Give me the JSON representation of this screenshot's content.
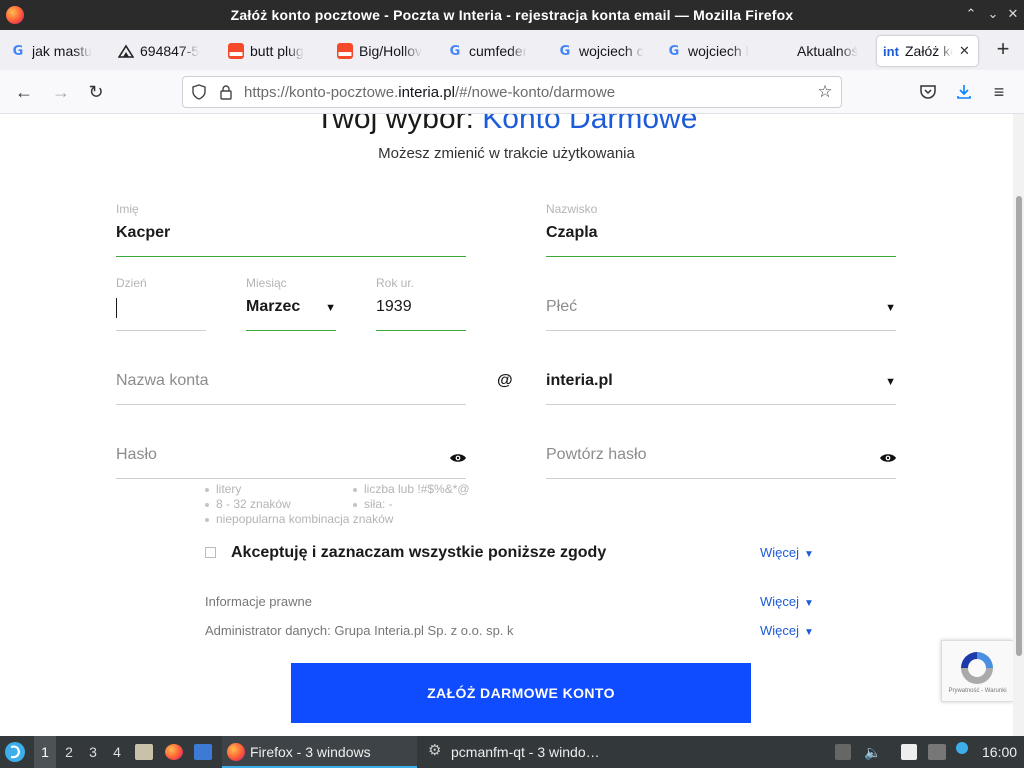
{
  "window": {
    "title": "Załóż konto pocztowe - Poczta w Interia - rejestracja konta email — Mozilla Firefox",
    "controls": [
      "⌃",
      "⌄",
      "✕"
    ]
  },
  "tabs": [
    {
      "label": "jak mastu",
      "icon": "google-icon"
    },
    {
      "label": "694847-5",
      "icon": "site-icon"
    },
    {
      "label": "butt plug",
      "icon": "store-icon"
    },
    {
      "label": "Big/Hollov",
      "icon": "store-icon"
    },
    {
      "label": "cumfeder",
      "icon": "google-icon"
    },
    {
      "label": "wojciech c",
      "icon": "google-icon"
    },
    {
      "label": "wojciech l",
      "icon": "google-icon"
    },
    {
      "label": "Aktualnoś",
      "icon": "none"
    },
    {
      "label": "Załóż ko",
      "icon": "interia-icon",
      "active": true,
      "icon_text": "int"
    }
  ],
  "navbar": {
    "url_prefix": "https://konto-pocztowe.",
    "url_domain": "interia.pl",
    "url_suffix": "/#/nowe-konto/darmowe"
  },
  "page": {
    "heading_prefix": "Twój wybór: ",
    "heading_accent": "Konto Darmowe",
    "subheading": "Możesz zmienić w trakcie użytkowania",
    "first_name": {
      "label": "Imię",
      "value": "Kacper"
    },
    "last_name": {
      "label": "Nazwisko",
      "value": "Czapla"
    },
    "day": {
      "label": "Dzień",
      "value": ""
    },
    "month": {
      "label": "Miesiąc",
      "value": "Marzec"
    },
    "year": {
      "label": "Rok ur.",
      "value": "1939"
    },
    "gender": {
      "placeholder": "Płeć"
    },
    "account_name": {
      "placeholder": "Nazwa konta"
    },
    "at_sign": "@",
    "domain": {
      "value": "interia.pl"
    },
    "password": {
      "placeholder": "Hasło"
    },
    "password_repeat": {
      "placeholder": "Powtórz hasło"
    },
    "password_hints_left": [
      "litery",
      "8 - 32 znaków",
      "niepopularna kombinacja znaków"
    ],
    "password_hints_right": [
      "liczba lub !#$%&*@",
      "siła: -"
    ],
    "consent_label": "Akceptuję i zaznaczam wszystkie poniższe zgody",
    "more_label": "Więcej",
    "legal_info": "Informacje prawne",
    "data_admin": "Administrator danych: Grupa Interia.pl Sp. z o.o. sp. k",
    "submit_label": "ZAŁÓŻ DARMOWE KONTO",
    "recaptcha_text": "Prywatność - Warunki"
  },
  "taskbar": {
    "workspaces": [
      "1",
      "2",
      "3",
      "4"
    ],
    "active_workspace": "1",
    "tasks": [
      {
        "label": "Firefox - 3 windows",
        "active": true
      },
      {
        "label": "pcmanfm-qt - 3 windo…",
        "active": false
      }
    ],
    "clock": "16:00"
  },
  "colors": {
    "accent": "#1c5bd9",
    "submit": "#0f4bff",
    "valid_line": "#3aa83a",
    "titlebar": "#2b2b2b",
    "taskbar": "#33383b"
  }
}
